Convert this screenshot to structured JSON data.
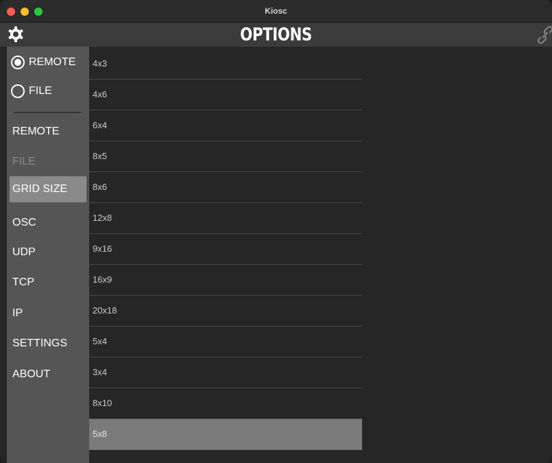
{
  "window": {
    "title": "Kiosc"
  },
  "header": {
    "title": "OPTIONS",
    "left_icon": "gear-icon",
    "right_icon": "link-icon"
  },
  "sidebar": {
    "radios": [
      {
        "label": "REMOTE",
        "selected": true
      },
      {
        "label": "FILE",
        "selected": false
      }
    ],
    "items": [
      {
        "label": "REMOTE",
        "state": "normal"
      },
      {
        "label": "FILE",
        "state": "disabled"
      },
      {
        "label": "GRID SIZE",
        "state": "active"
      },
      {
        "label": "OSC",
        "state": "normal"
      },
      {
        "label": "UDP",
        "state": "normal"
      },
      {
        "label": "TCP",
        "state": "normal"
      },
      {
        "label": "IP",
        "state": "normal"
      },
      {
        "label": "SETTINGS",
        "state": "normal"
      },
      {
        "label": "ABOUT",
        "state": "normal"
      }
    ]
  },
  "grid_sizes": {
    "items": [
      "4x3",
      "4x6",
      "6x4",
      "8x5",
      "8x6",
      "12x8",
      "9x16",
      "16x9",
      "20x18",
      "5x4",
      "3x4",
      "8x10",
      "5x8"
    ],
    "selected": "5x8"
  },
  "colors": {
    "accent_selected": "#7a7a7a",
    "sidebar_bg": "#555555",
    "header_bg": "#3b3b3b"
  }
}
